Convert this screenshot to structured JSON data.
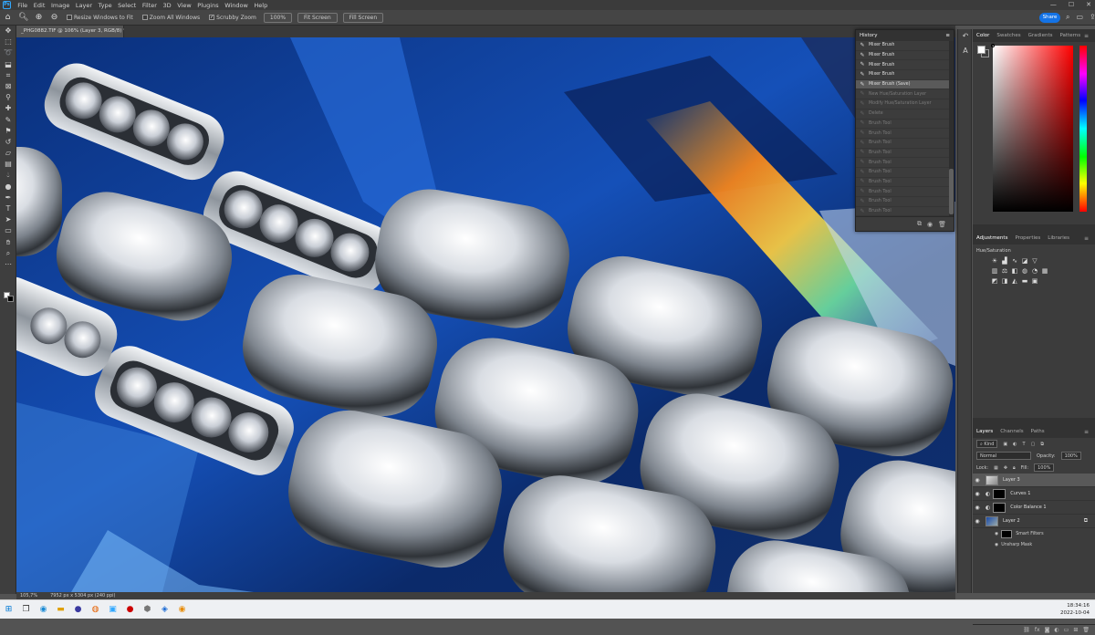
{
  "menubar": {
    "logo": "Ps",
    "items": [
      "File",
      "Edit",
      "Image",
      "Layer",
      "Type",
      "Select",
      "Filter",
      "3D",
      "View",
      "Plugins",
      "Window",
      "Help"
    ],
    "window_controls": [
      "—",
      "☐",
      "✕"
    ]
  },
  "options": {
    "resize_windows": "Resize Windows to Fit",
    "zoom_all": "Zoom All Windows",
    "scrubby_zoom": "Scrubby Zoom",
    "zoom_value": "100%",
    "fit_screen": "Fit Screen",
    "fill_screen": "Fill Screen",
    "share": "Share"
  },
  "document": {
    "tab_title": "_PHG0882.TIF @ 106% (Layer 3, RGB/8) *",
    "close": "×"
  },
  "status": {
    "zoom": "105,7%",
    "size": "7952 px x 5304 px (240 ppi)"
  },
  "history": {
    "title": "History",
    "items": [
      {
        "label": "Mixer Brush",
        "state": "on"
      },
      {
        "label": "Mixer Brush",
        "state": "on"
      },
      {
        "label": "Mixer Brush",
        "state": "on"
      },
      {
        "label": "Mixer Brush",
        "state": "on"
      },
      {
        "label": "Mixer Brush (Save)",
        "state": "sel"
      },
      {
        "label": "New Hue/Saturation Layer",
        "state": "off"
      },
      {
        "label": "Modify Hue/Saturation Layer",
        "state": "off"
      },
      {
        "label": "Delete",
        "state": "off"
      },
      {
        "label": "Brush Tool",
        "state": "off"
      },
      {
        "label": "Brush Tool",
        "state": "off"
      },
      {
        "label": "Brush Tool",
        "state": "off"
      },
      {
        "label": "Brush Tool",
        "state": "off"
      },
      {
        "label": "Brush Tool",
        "state": "off"
      },
      {
        "label": "Brush Tool",
        "state": "off"
      },
      {
        "label": "Brush Tool",
        "state": "off"
      },
      {
        "label": "Brush Tool",
        "state": "off"
      },
      {
        "label": "Brush Tool",
        "state": "off"
      },
      {
        "label": "Brush Tool",
        "state": "off"
      }
    ]
  },
  "color_panel": {
    "tabs": [
      "Color",
      "Swatches",
      "Gradients",
      "Patterns"
    ]
  },
  "adjustments_panel": {
    "tabs": [
      "Adjustments",
      "Properties",
      "Libraries"
    ],
    "hover_label": "Hue/Saturation"
  },
  "layers_panel": {
    "tabs": [
      "Layers",
      "Channels",
      "Paths"
    ],
    "kind": "Kind",
    "blend_mode": "Normal",
    "opacity_label": "Opacity:",
    "opacity_value": "100%",
    "lock_label": "Lock:",
    "fill_label": "Fill:",
    "fill_value": "100%",
    "layers": [
      {
        "name": "Layer 3",
        "selected": true,
        "type": "pixel"
      },
      {
        "name": "Curves 1",
        "selected": false,
        "type": "adjust"
      },
      {
        "name": "Color Balance 1",
        "selected": false,
        "type": "adjust"
      },
      {
        "name": "Layer 2",
        "selected": false,
        "type": "smart"
      }
    ],
    "smart_filters": "Smart Filters",
    "unsharp_mask": "Unsharp Mask"
  },
  "taskbar": {
    "time": "18:34:16",
    "date": "2022-10-04"
  },
  "colors": {
    "accent": "#1473e6",
    "panel": "#3c3c3c",
    "canvas_blue": "#0d3d8a"
  }
}
